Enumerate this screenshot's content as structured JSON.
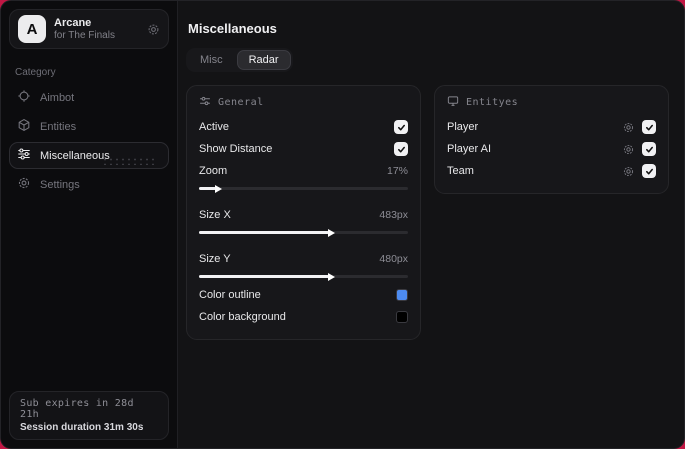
{
  "app": {
    "logo_letter": "A",
    "name": "Arcane",
    "subtitle": "for The Finals"
  },
  "sidebar": {
    "category_label": "Category",
    "items": [
      {
        "label": "Aimbot",
        "icon": "crosshair-icon",
        "active": false
      },
      {
        "label": "Entities",
        "icon": "cube-icon",
        "active": false
      },
      {
        "label": "Miscellaneous",
        "icon": "sliders-icon",
        "active": true
      },
      {
        "label": "Settings",
        "icon": "gear-icon",
        "active": false
      }
    ],
    "footer": {
      "line1": "Sub expires in 28d 21h",
      "line2": "Session duration 31m 30s"
    }
  },
  "main": {
    "title": "Miscellaneous",
    "tabs": [
      {
        "label": "Misc",
        "active": false
      },
      {
        "label": "Radar",
        "active": true
      }
    ]
  },
  "general": {
    "title": "General",
    "active": {
      "label": "Active",
      "checked": true
    },
    "show_distance": {
      "label": "Show Distance",
      "checked": true
    },
    "zoom": {
      "label": "Zoom",
      "value": "17%",
      "fill_pct": 8
    },
    "size_x": {
      "label": "Size X",
      "value": "483px",
      "fill_pct": 62
    },
    "size_y": {
      "label": "Size Y",
      "value": "480px",
      "fill_pct": 62
    },
    "color_outline": {
      "label": "Color outline",
      "swatch": "#4d8bf0"
    },
    "color_background": {
      "label": "Color background",
      "swatch": "#000000"
    }
  },
  "entities": {
    "title": "Entityes",
    "items": [
      {
        "label": "Player",
        "checked": true
      },
      {
        "label": "Player AI",
        "checked": true
      },
      {
        "label": "Team",
        "checked": true
      }
    ]
  },
  "colors": {
    "backdrop_red": "#c11744",
    "accent_blue": "#4d8bf0"
  }
}
